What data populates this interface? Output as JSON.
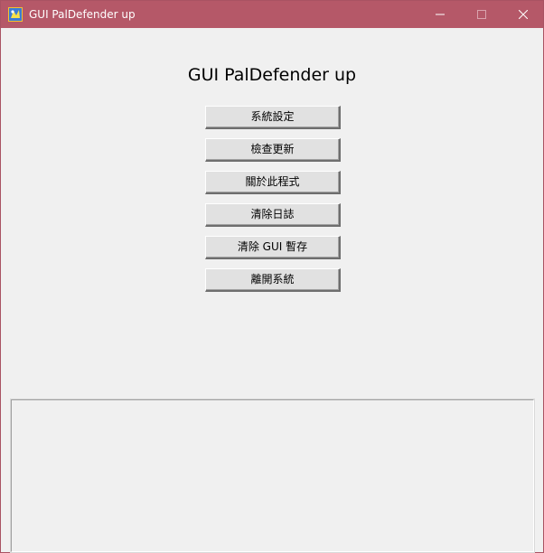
{
  "window": {
    "title": "GUI PalDefender up",
    "titlebar_color": "#b55868",
    "icons": [
      "app-icon",
      "minimize-icon",
      "maximize-icon",
      "close-icon"
    ]
  },
  "main": {
    "heading": "GUI PalDefender up",
    "buttons": [
      {
        "label": "系統設定"
      },
      {
        "label": "檢查更新"
      },
      {
        "label": "關於此程式"
      },
      {
        "label": "清除日誌"
      },
      {
        "label": "清除 GUI 暫存"
      },
      {
        "label": "離開系統"
      }
    ],
    "log": {
      "text": ""
    }
  }
}
